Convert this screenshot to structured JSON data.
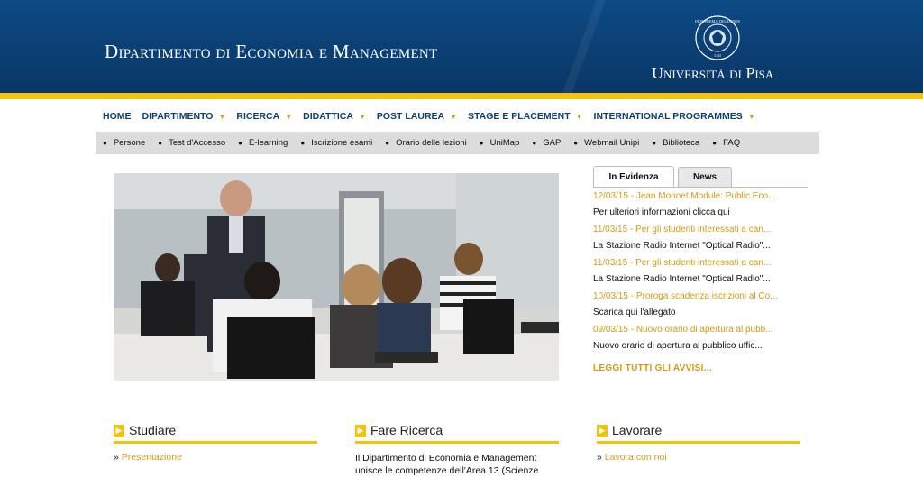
{
  "header": {
    "department": "Dipartimento di Economia e Management",
    "university": "Università di Pisa",
    "seal": {
      "ring_text": "IN SUPREMÆ DIGNITATIS",
      "year": "1343"
    }
  },
  "colors": {
    "header_blue": "#0b3f73",
    "accent_gold": "#f4c20d",
    "link_gold": "#d79a10"
  },
  "main_nav": [
    {
      "label": "HOME",
      "dropdown": false
    },
    {
      "label": "DIPARTIMENTO",
      "dropdown": true
    },
    {
      "label": "RICERCA",
      "dropdown": true
    },
    {
      "label": "DIDATTICA",
      "dropdown": true
    },
    {
      "label": "POST LAUREA",
      "dropdown": true
    },
    {
      "label": "STAGE E PLACEMENT",
      "dropdown": true
    },
    {
      "label": "INTERNATIONAL PROGRAMMES",
      "dropdown": true
    }
  ],
  "sub_nav": [
    "Persone",
    "Test d'Accesso",
    "E-learning",
    "Iscrizione esami",
    "Orario delle lezioni",
    "UniMap",
    "GAP",
    "Webmail Unipi",
    "Biblioteca",
    "FAQ"
  ],
  "tabs": {
    "active": "In Evidenza",
    "other": "News"
  },
  "news": [
    {
      "title": "12/03/15 - Jean Monnet Module: Public Eco...",
      "desc": "Per ulteriori informazioni clicca qui"
    },
    {
      "title": "11/03/15 - Per gli studenti interessati a can...",
      "desc": "La Stazione Radio Internet \"Optical Radio\"..."
    },
    {
      "title": "11/03/15 - Per gli studenti interessati a can...",
      "desc": "La Stazione Radio Internet \"Optical Radio\"..."
    },
    {
      "title": "10/03/15 - Proroga scadenza iscrizioni al Co...",
      "desc": "Scarica qui l'allegato"
    },
    {
      "title": "09/03/15 - Nuovo orario di apertura al pubb...",
      "desc": "Nuovo orario di apertura al pubblico uffic..."
    }
  ],
  "read_all": "LEGGI TUTTI GLI AVVISI...",
  "sections": {
    "studiare": {
      "title": "Studiare",
      "link": "Presentazione"
    },
    "ricerca": {
      "title": "Fare Ricerca",
      "text": "Il Dipartimento di Economia e Management unisce le competenze dell'Area 13 (Scienze"
    },
    "lavorare": {
      "title": "Lavorare",
      "link": "Lavora con noi"
    }
  }
}
